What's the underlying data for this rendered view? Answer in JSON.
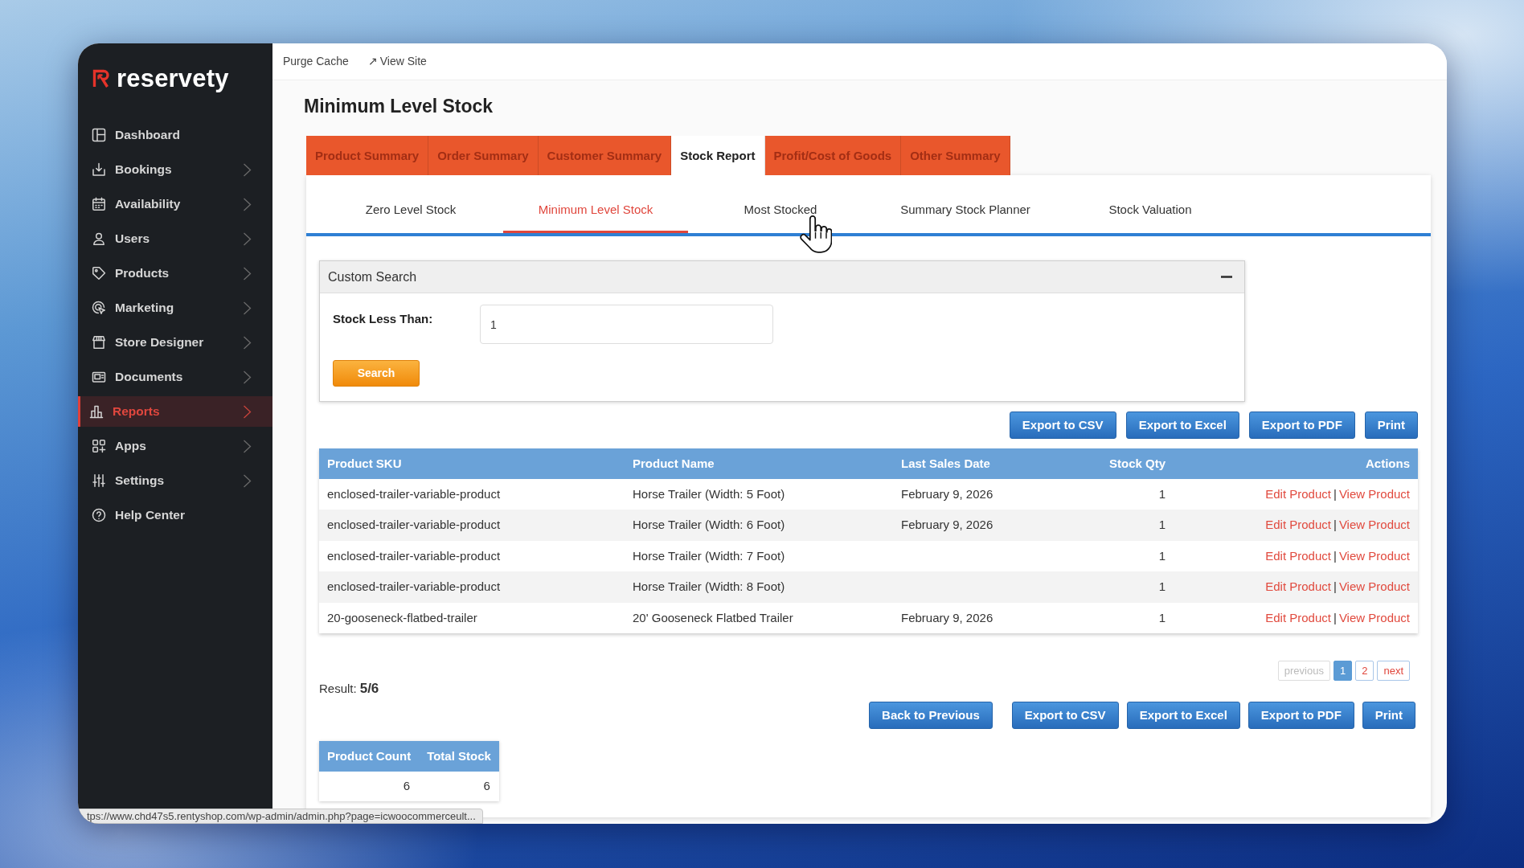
{
  "top_bar": {
    "links": [
      {
        "label": "Purge Cache"
      },
      {
        "glyph": "↗",
        "label": "View Site"
      }
    ]
  },
  "sidebar": {
    "brand": "reservety",
    "items": [
      {
        "label": "Dashboard",
        "has_submenu": false,
        "selected": false
      },
      {
        "label": "Bookings",
        "has_submenu": true,
        "selected": false
      },
      {
        "label": "Availability",
        "has_submenu": true,
        "selected": false
      },
      {
        "label": "Users",
        "has_submenu": true,
        "selected": false
      },
      {
        "label": "Products",
        "has_submenu": true,
        "selected": false
      },
      {
        "label": "Marketing",
        "has_submenu": true,
        "selected": false
      },
      {
        "label": "Store Designer",
        "has_submenu": true,
        "selected": false
      },
      {
        "label": "Documents",
        "has_submenu": true,
        "selected": false
      },
      {
        "label": "Reports",
        "has_submenu": true,
        "selected": true
      },
      {
        "label": "Apps",
        "has_submenu": true,
        "selected": false
      },
      {
        "label": "Settings",
        "has_submenu": true,
        "selected": false
      },
      {
        "label": "Help Center",
        "has_submenu": false,
        "selected": false
      }
    ]
  },
  "page_title": "Minimum Level Stock",
  "report_tabs": [
    {
      "label": "Product Summary",
      "selected": false
    },
    {
      "label": "Order Summary",
      "selected": false
    },
    {
      "label": "Customer Summary",
      "selected": false
    },
    {
      "label": "Stock Report",
      "selected": true
    },
    {
      "label": "Profit/Cost of Goods",
      "selected": false
    },
    {
      "label": "Other Summary",
      "selected": false
    }
  ],
  "stock_tabs": [
    {
      "label": "Zero Level Stock",
      "selected": false
    },
    {
      "label": "Minimum Level Stock",
      "selected": true
    },
    {
      "label": "Most Stocked",
      "selected": false
    },
    {
      "label": "Summary Stock Planner",
      "selected": false
    },
    {
      "label": "Stock Valuation",
      "selected": false
    }
  ],
  "custom_search": {
    "title": "Custom Search",
    "expanded": true,
    "field": {
      "label": "Stock Less Than:",
      "value": "1"
    },
    "button": "Search"
  },
  "export_buttons": [
    "Export to CSV",
    "Export to Excel",
    "Export to PDF",
    "Print"
  ],
  "table": {
    "columns": [
      "Product SKU",
      "Product Name",
      "Last Sales Date",
      "Stock Qty",
      "Actions"
    ],
    "rows": [
      {
        "sku": "enclosed-trailer-variable-product",
        "product_name": "Horse Trailer (Width: 5 Foot)",
        "last_sales_date": "February 9, 2026",
        "stock_qty": "1",
        "actions": [
          {
            "kind": "link",
            "text": "Edit Product"
          },
          {
            "kind": "separator",
            "text": "|"
          },
          {
            "kind": "link",
            "text": "View Product"
          }
        ]
      },
      {
        "sku": "enclosed-trailer-variable-product",
        "product_name": "Horse Trailer (Width: 6 Foot)",
        "last_sales_date": "February 9, 2026",
        "stock_qty": "1",
        "actions": [
          {
            "kind": "link",
            "text": "Edit Product"
          },
          {
            "kind": "separator",
            "text": "|"
          },
          {
            "kind": "link",
            "text": "View Product"
          }
        ]
      },
      {
        "sku": "enclosed-trailer-variable-product",
        "product_name": "Horse Trailer (Width: 7 Foot)",
        "stock_qty": "1",
        "actions": [
          {
            "kind": "link",
            "text": "Edit Product"
          },
          {
            "kind": "separator",
            "text": "|"
          },
          {
            "kind": "link",
            "text": "View Product"
          }
        ]
      },
      {
        "sku": "enclosed-trailer-variable-product",
        "product_name": "Horse Trailer (Width: 8 Foot)",
        "stock_qty": "1",
        "actions": [
          {
            "kind": "link",
            "text": "Edit Product"
          },
          {
            "kind": "separator",
            "text": "|"
          },
          {
            "kind": "link",
            "text": "View Product"
          }
        ]
      },
      {
        "sku": "20-gooseneck-flatbed-trailer",
        "product_name": "20' Gooseneck Flatbed Trailer",
        "last_sales_date": "February 9, 2026",
        "stock_qty": "1",
        "actions": [
          {
            "kind": "link",
            "text": "Edit Product"
          },
          {
            "kind": "separator",
            "text": "|"
          },
          {
            "kind": "link",
            "text": "View Product"
          }
        ]
      }
    ]
  },
  "pagination": [
    {
      "label": "previous",
      "selected": false,
      "disabled": true
    },
    {
      "label": "1",
      "selected": true,
      "disabled": false
    },
    {
      "label": "2",
      "selected": false,
      "disabled": false
    },
    {
      "label": "next",
      "selected": false,
      "disabled": false
    }
  ],
  "result": {
    "label": "Result:",
    "value": "5/6"
  },
  "bottom_buttons": {
    "back": "Back to Previous",
    "exports": [
      "Export to CSV",
      "Export to Excel",
      "Export to PDF",
      "Print"
    ]
  },
  "summary_table": {
    "columns": [
      "Product Count",
      "Total Stock"
    ],
    "rows": [
      [
        "6",
        "6"
      ]
    ]
  },
  "status_url": "tps://www.chd47s5.rentyshop.com/wp-admin/admin.php?page=icwoocommerceult..."
}
